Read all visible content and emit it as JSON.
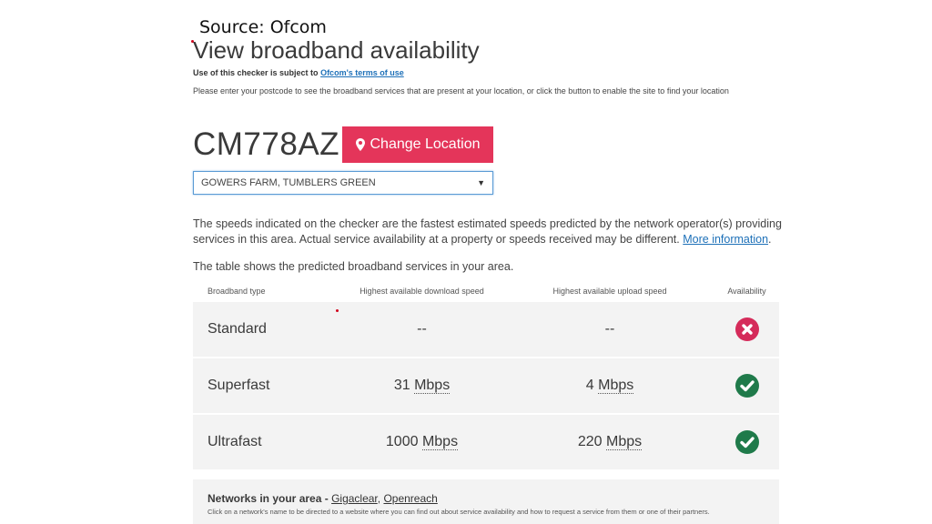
{
  "source": "Source: Ofcom",
  "page_title": "View broadband availability",
  "terms": {
    "prefix": "Use of this checker is subject to",
    "link": "Ofcom's terms of use"
  },
  "instructions": "Please enter your postcode to see the broadband services that are present at your location, or click the button to enable the site to find your location",
  "postcode": "CM778AZ",
  "change_location_label": "Change Location",
  "address_select": {
    "selected": "GOWERS FARM, TUMBLERS GREEN"
  },
  "info": {
    "speeds_text": "The speeds indicated on the checker are the fastest estimated speeds predicted by the network operator(s) providing services in this area. Actual service availability at a property or speeds received may be different.",
    "more_info_link": "More information",
    "period": ".",
    "table_intro": "The table shows the predicted broadband services in your area."
  },
  "table": {
    "headers": [
      "Broadband type",
      "Highest available download speed",
      "Highest available upload speed",
      "Availability"
    ],
    "rows": [
      {
        "type": "Standard",
        "download_value": "--",
        "download_unit": "",
        "upload_value": "--",
        "upload_unit": "",
        "available": false
      },
      {
        "type": "Superfast",
        "download_value": "31",
        "download_unit": "Mbps",
        "upload_value": "4",
        "upload_unit": "Mbps",
        "available": true
      },
      {
        "type": "Ultrafast",
        "download_value": "1000",
        "download_unit": "Mbps",
        "upload_value": "220",
        "upload_unit": "Mbps",
        "available": true
      }
    ]
  },
  "networks": {
    "label": "Networks in your area -",
    "links": [
      "Gigaclear",
      "Openreach"
    ],
    "separator": ",",
    "note": "Click on a network's name to be directed to a website where you can find out about service availability and how to request a service from them or one of their partners."
  },
  "colors": {
    "accent": "#e4355a",
    "link": "#1d70b8",
    "ok": "#1f7a4a",
    "fail": "#d52b5a"
  }
}
